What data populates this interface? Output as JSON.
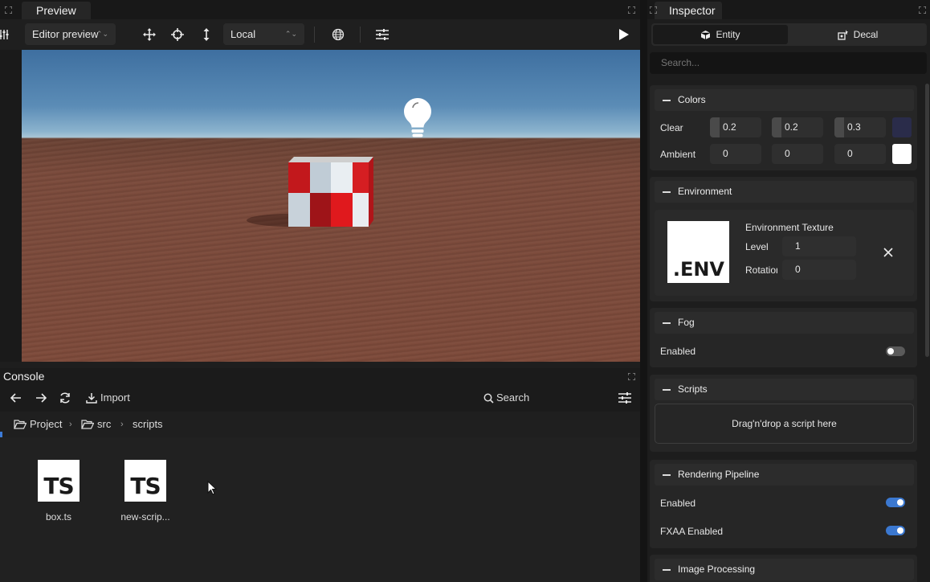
{
  "preview": {
    "tab_label": "Preview",
    "camera_select": "Editor preview",
    "space_select": "Local"
  },
  "console": {
    "title": "Console",
    "import_label": "Import",
    "search_label": "Search",
    "breadcrumb": [
      "Project",
      "src",
      "scripts"
    ],
    "files": [
      {
        "icon_text": "TS",
        "name": "box.ts"
      },
      {
        "icon_text": "TS",
        "name": "new-scrip..."
      }
    ]
  },
  "inspector": {
    "tab_label": "Inspector",
    "segments": [
      "Entity",
      "Decal"
    ],
    "search_placeholder": "Search...",
    "colors": {
      "title": "Colors",
      "clear_label": "Clear",
      "clear_values": [
        "0.2",
        "0.2",
        "0.3"
      ],
      "ambient_label": "Ambient",
      "ambient_values": [
        "0",
        "0",
        "0"
      ],
      "clear_color": "#2a2c4a",
      "ambient_color": "#ffffff"
    },
    "environment": {
      "title": "Environment",
      "thumb_text": ".ENV",
      "texture_label": "Environment Texture",
      "level_label": "Level",
      "level_value": "1",
      "rotation_label": "Rotation",
      "rotation_value": "0"
    },
    "fog": {
      "title": "Fog",
      "enabled_label": "Enabled",
      "enabled": false
    },
    "scripts": {
      "title": "Scripts",
      "drop_text": "Drag'n'drop a script here"
    },
    "rendering": {
      "title": "Rendering Pipeline",
      "enabled_label": "Enabled",
      "enabled": true,
      "fxaa_label": "FXAA Enabled",
      "fxaa": true
    },
    "image_processing": {
      "title": "Image Processing"
    }
  },
  "colors": {
    "accent": "#3b78d0",
    "panel": "#262626",
    "background": "#1e1e1e"
  }
}
